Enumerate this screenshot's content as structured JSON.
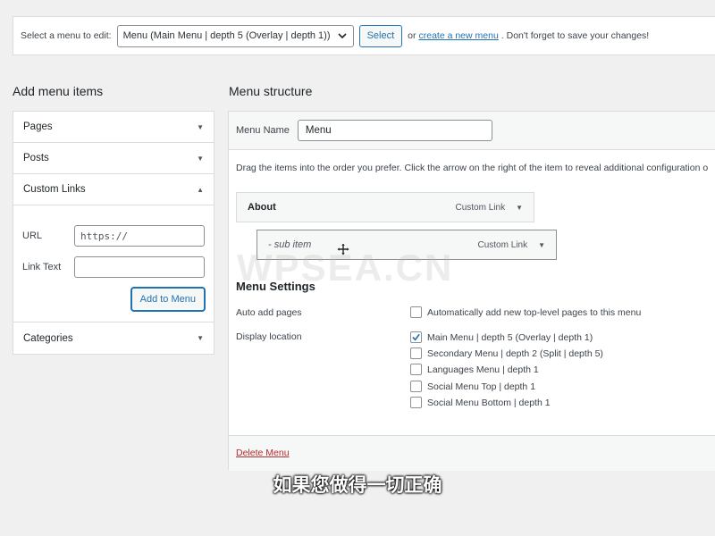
{
  "select_bar": {
    "label": "Select a menu to edit:",
    "selected_menu": "Menu (Main Menu | depth 5 (Overlay | depth 1))",
    "select_button": "Select",
    "or_text": "or",
    "create_link": "create a new menu",
    "save_hint": ". Don't forget to save your changes!"
  },
  "add_menu_items": {
    "title": "Add menu items",
    "sections": {
      "pages": "Pages",
      "posts": "Posts",
      "custom_links": "Custom Links",
      "categories": "Categories"
    },
    "url_label": "URL",
    "url_value": "https://",
    "link_text_label": "Link Text",
    "link_text_value": "",
    "add_button": "Add to Menu"
  },
  "menu_structure": {
    "title": "Menu structure",
    "menu_name_label": "Menu Name",
    "menu_name_value": "Menu",
    "instructions": "Drag the items into the order you prefer. Click the arrow on the right of the item to reveal additional configuration o",
    "items": [
      {
        "title": "About",
        "type": "Custom Link"
      },
      {
        "title": "-  sub item",
        "type": "Custom Link"
      }
    ]
  },
  "menu_settings": {
    "title": "Menu Settings",
    "auto_add_label": "Auto add pages",
    "auto_add_option": "Automatically add new top-level pages to this menu",
    "auto_add_checked": false,
    "display_location_label": "Display location",
    "locations": [
      {
        "label": "Main Menu | depth 5 (Overlay | depth 1)",
        "checked": true
      },
      {
        "label": "Secondary Menu | depth 2 (Split | depth 5)",
        "checked": false
      },
      {
        "label": "Languages Menu | depth 1",
        "checked": false
      },
      {
        "label": "Social Menu Top | depth 1",
        "checked": false
      },
      {
        "label": "Social Menu Bottom | depth 1",
        "checked": false
      }
    ],
    "delete_link": "Delete Menu"
  },
  "watermark": "WPSEA.CN",
  "subtitle": "如果您做得一切正确",
  "colors": {
    "accent": "#2271b1",
    "delete": "#b32d2e",
    "background": "#f0f0f1"
  }
}
